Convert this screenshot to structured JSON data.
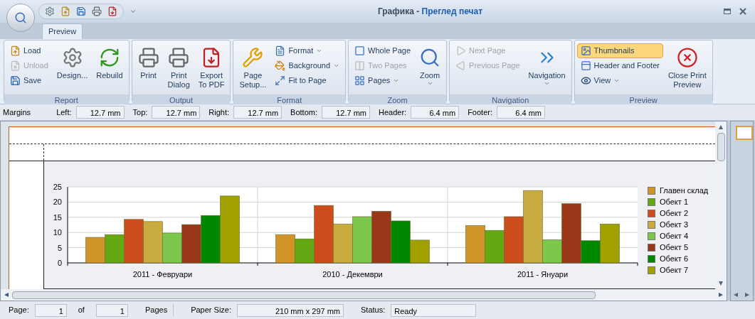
{
  "window": {
    "title_app": "Графика",
    "title_separator": " - ",
    "title_doc": "Преглед печат"
  },
  "tabs": [
    {
      "label": "Preview",
      "selected": true
    }
  ],
  "ribbon_groups": [
    {
      "label": "Report",
      "items": [
        {
          "kind": "small",
          "label": "Load",
          "disabled": false
        },
        {
          "kind": "small",
          "label": "Unload",
          "disabled": true
        },
        {
          "kind": "small",
          "label": "Save",
          "disabled": false
        },
        {
          "kind": "large",
          "label": "Design...",
          "disabled": false
        },
        {
          "kind": "large",
          "label": "Rebuild",
          "disabled": false
        }
      ]
    },
    {
      "label": "Output",
      "items": [
        {
          "kind": "large",
          "label": "Print",
          "disabled": false
        },
        {
          "kind": "large",
          "label": "Print\nDialog",
          "disabled": false
        },
        {
          "kind": "large",
          "label": "Export\nTo PDF",
          "disabled": false
        }
      ]
    },
    {
      "label": "Format",
      "items": [
        {
          "kind": "large",
          "label": "Page\nSetup...",
          "disabled": false
        },
        {
          "kind": "small",
          "label": "Format",
          "disabled": false,
          "dropdown": true
        },
        {
          "kind": "small",
          "label": "Background",
          "disabled": false,
          "dropdown": true
        },
        {
          "kind": "small",
          "label": "Fit to Page",
          "disabled": false
        }
      ]
    },
    {
      "label": "Zoom",
      "items": [
        {
          "kind": "small",
          "label": "Whole Page",
          "disabled": false
        },
        {
          "kind": "small",
          "label": "Two Pages",
          "disabled": true
        },
        {
          "kind": "small",
          "label": "Pages",
          "disabled": false,
          "dropdown": true
        },
        {
          "kind": "large",
          "label": "Zoom",
          "disabled": false,
          "dropdown": true
        }
      ]
    },
    {
      "label": "Navigation",
      "items": [
        {
          "kind": "small",
          "label": "Next Page",
          "disabled": true
        },
        {
          "kind": "small",
          "label": "Previous Page",
          "disabled": true
        },
        {
          "kind": "large",
          "label": "Navigation",
          "disabled": false,
          "dropdown": true
        }
      ]
    },
    {
      "label": "Preview",
      "items": [
        {
          "kind": "small",
          "label": "Thumbnails",
          "disabled": false,
          "selected": true
        },
        {
          "kind": "small",
          "label": "Header and Footer",
          "disabled": false,
          "selected": false
        },
        {
          "kind": "small",
          "label": "View",
          "disabled": false,
          "dropdown": true,
          "selected": false
        },
        {
          "kind": "large",
          "label": "Close Print\nPreview",
          "disabled": false
        }
      ]
    }
  ],
  "margins": {
    "label": "Margins",
    "fields": [
      {
        "label": "Left:",
        "value": "12.7 mm"
      },
      {
        "label": "Top:",
        "value": "12.7 mm"
      },
      {
        "label": "Right:",
        "value": "12.7 mm"
      },
      {
        "label": "Bottom:",
        "value": "12.7 mm"
      },
      {
        "label": "Header:",
        "value": "6.4 mm"
      },
      {
        "label": "Footer:",
        "value": "6.4 mm"
      }
    ]
  },
  "chart_data": {
    "type": "bar",
    "grid": true,
    "legend": true,
    "categories": [
      "2011 - Февруари",
      "2010 - Декември",
      "2011 - Януари"
    ],
    "ylim": [
      0,
      25
    ],
    "yticks": [
      0,
      5,
      10,
      15,
      20,
      25
    ],
    "series": [
      {
        "name": "Главен склад",
        "color": "#d09428",
        "values": [
          8.4,
          9.3,
          12.3
        ]
      },
      {
        "name": "Обект 1",
        "color": "#64a814",
        "values": [
          9.3,
          7.9,
          10.7
        ]
      },
      {
        "name": "Обект 2",
        "color": "#cc4c1c",
        "values": [
          14.3,
          18.9,
          15.2
        ]
      },
      {
        "name": "Обект 3",
        "color": "#c8ac40",
        "values": [
          13.6,
          12.8,
          23.8
        ]
      },
      {
        "name": "Обект 4",
        "color": "#7cc84c",
        "values": [
          9.8,
          15.2,
          7.6
        ]
      },
      {
        "name": "Обект 5",
        "color": "#983818",
        "values": [
          12.6,
          17.0,
          19.5
        ]
      },
      {
        "name": "Обект 6",
        "color": "#008800",
        "values": [
          15.6,
          13.8,
          7.3
        ]
      },
      {
        "name": "Обект 7",
        "color": "#a0a000",
        "values": [
          22.0,
          7.5,
          12.8
        ]
      }
    ]
  },
  "status_bar": {
    "page_label": "Page:",
    "page": "1",
    "of_label": "of",
    "pages": "1",
    "pages_label": "Pages",
    "paper_label": "Paper Size:",
    "paper": "210 mm x 297 mm",
    "status_label": "Status:",
    "status": "Ready"
  }
}
